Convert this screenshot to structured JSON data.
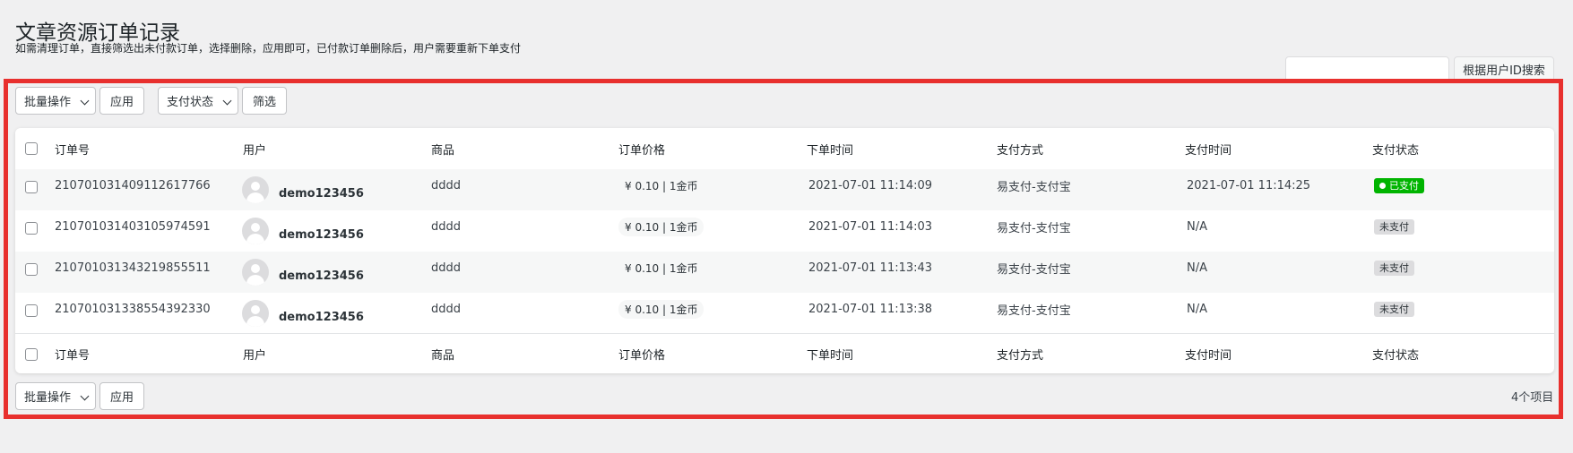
{
  "page": {
    "title": "文章资源订单记录",
    "description": "如需清理订单，直接筛选出未付款订单，选择删除，应用即可，已付款订单删除后，用户需要重新下单支付"
  },
  "search": {
    "value": "",
    "button_label": "根据用户ID搜索"
  },
  "toolbar_top": {
    "bulk_action": "批量操作",
    "apply": "应用",
    "pay_status_filter": "支付状态",
    "filter": "筛选"
  },
  "toolbar_bottom": {
    "bulk_action": "批量操作",
    "apply": "应用",
    "item_count": "4个项目"
  },
  "table": {
    "columns": [
      "订单号",
      "用户",
      "商品",
      "订单价格",
      "下单时间",
      "支付方式",
      "支付时间",
      "支付状态"
    ],
    "rows": [
      {
        "order_no": "210701031409112617766",
        "user": "demo123456",
        "product": "dddd",
        "price": "¥ 0.10 | 1金币",
        "order_time": "2021-07-01 11:14:09",
        "pay_method": "易支付-支付宝",
        "pay_time": "2021-07-01 11:14:25",
        "status": "已支付"
      },
      {
        "order_no": "210701031403105974591",
        "user": "demo123456",
        "product": "dddd",
        "price": "¥ 0.10 | 1金币",
        "order_time": "2021-07-01 11:14:03",
        "pay_method": "易支付-支付宝",
        "pay_time": "N/A",
        "status": "未支付"
      },
      {
        "order_no": "210701031343219855511",
        "user": "demo123456",
        "product": "dddd",
        "price": "¥ 0.10 | 1金币",
        "order_time": "2021-07-01 11:13:43",
        "pay_method": "易支付-支付宝",
        "pay_time": "N/A",
        "status": "未支付"
      },
      {
        "order_no": "210701031338554392330",
        "user": "demo123456",
        "product": "dddd",
        "price": "¥ 0.10 | 1金币",
        "order_time": "2021-07-01 11:13:38",
        "pay_method": "易支付-支付宝",
        "pay_time": "N/A",
        "status": "未支付"
      }
    ]
  },
  "colors": {
    "highlight_frame": "#e8302e",
    "paid_badge": "#00b400",
    "unpaid_badge": "#dcdcde"
  }
}
